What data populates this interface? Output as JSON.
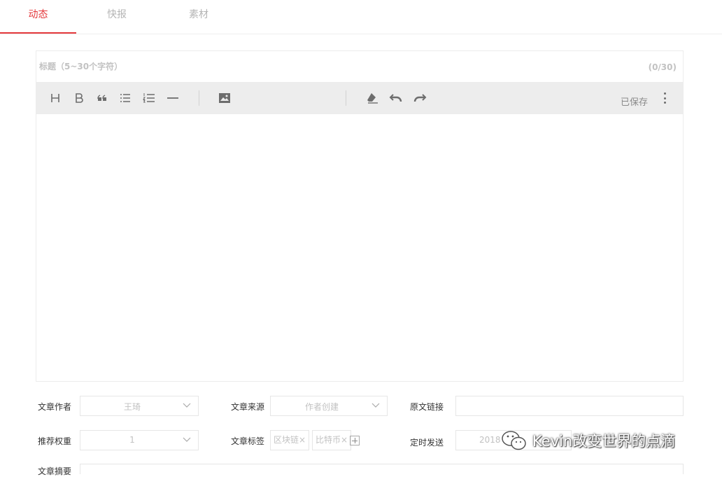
{
  "tabs": [
    {
      "label": "动态",
      "active": true
    },
    {
      "label": "快报",
      "active": false
    },
    {
      "label": "素材",
      "active": false
    }
  ],
  "editor": {
    "title_placeholder": "标题（5~30个字符）",
    "title_counter": "(0/30)",
    "saved_status": "已保存",
    "toolbar_icons": [
      "heading-icon",
      "bold-icon",
      "quote-icon",
      "bullet-list-icon",
      "numbered-list-icon",
      "divider-icon",
      "image-icon",
      "clear-format-icon",
      "undo-icon",
      "redo-icon",
      "more-vertical-icon"
    ]
  },
  "form": {
    "author_label": "文章作者",
    "author_value": "王琦",
    "source_label": "文章来源",
    "source_value": "作者创建",
    "link_label": "原文链接",
    "link_value": "",
    "weight_label": "推荐权重",
    "weight_value": "1",
    "tags_label": "文章标签",
    "tags": [
      "区块链×",
      "比特币×"
    ],
    "schedule_label": "定时发送",
    "schedule_value": "2018",
    "summary_label": "文章摘要"
  },
  "watermark": {
    "text": "Kevin改变世界的点滴"
  },
  "colors": {
    "accent": "#e4393c",
    "toolbar_bg": "#ededed",
    "muted_text": "#c2c2c2"
  }
}
